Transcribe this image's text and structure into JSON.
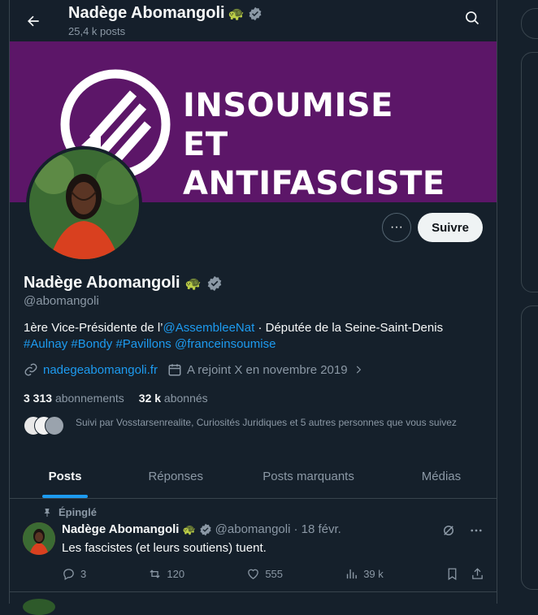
{
  "topbar": {
    "name": "Nadège Abomangoli",
    "posts_count": "25,4 k posts"
  },
  "banner": {
    "line1": "INSOUMISE",
    "line2": "ET ANTIFASCISTE"
  },
  "buttons": {
    "more": "···",
    "follow": "Suivre"
  },
  "profile": {
    "name": "Nadège Abomangoli",
    "handle": "@abomangoli",
    "bio_part1": "1ère Vice-Présidente de l’",
    "bio_mention1": "@AssembleeNat",
    "bio_part2": " · Députée de la Seine-Saint-Denis",
    "bio_tag1": "#Aulnay",
    "bio_tag2": "#Bondy",
    "bio_tag3": "#Pavillons",
    "bio_mention2": "@franceinsoumise",
    "website": "nadegeabomangoli.fr",
    "joined": "A rejoint X en novembre 2019",
    "following_count": "3 313",
    "following_label": "abonnements",
    "followers_count": "32 k",
    "followers_label": "abonnés",
    "followed_by": "Suivi par Vosstarsenrealite, Curiosités Juridiques et 5 autres personnes que vous suivez"
  },
  "tabs": [
    "Posts",
    "Réponses",
    "Posts marquants",
    "Médias"
  ],
  "tweet": {
    "pinned_label": "Épinglé",
    "name": "Nadège Abomangoli",
    "handle": "@abomangoli",
    "date": "· 18 févr.",
    "text": "Les fascistes (et leurs soutiens) tuent.",
    "replies": "3",
    "reposts": "120",
    "likes": "555",
    "views": "39 k"
  },
  "colors": {
    "background": "#15202b",
    "accent": "#1d9bf0",
    "banner": "#5c1668",
    "verified": "#8b98a5"
  }
}
